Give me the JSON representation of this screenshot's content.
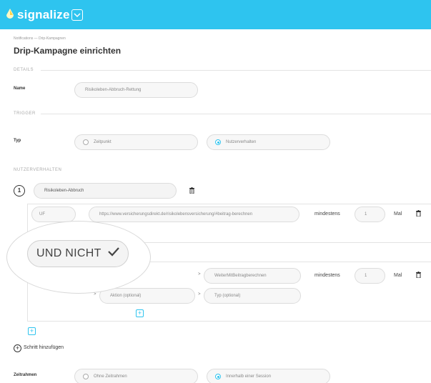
{
  "app": {
    "name": "signalize"
  },
  "breadcrumb": "Notifications — Drip-Kampagnen",
  "page_title": "Drip-Kampagne einrichten",
  "sections": {
    "details": "DETAILS",
    "trigger": "TRIGGER",
    "nutzerverhalten": "NUTZERVERHALTEN"
  },
  "details": {
    "name_label": "Name",
    "name_value": "Risikoleben-Abbruch-Rettung"
  },
  "trigger": {
    "typ_label": "Typ",
    "options": [
      {
        "label": "Zeitpunkt",
        "selected": false
      },
      {
        "label": "Nutzerverhalten",
        "selected": true
      }
    ]
  },
  "step1": {
    "number": "1",
    "name": "Risikoleben-Abbruch",
    "row1": {
      "prefix": "UF",
      "url": "https://www.versicherungsdirekt.de/risikolebensversicherung/#beitrag-berechnen",
      "mindestens_label": "mindestens",
      "count": "1",
      "unit": "Mal"
    },
    "row2": {
      "event": "WeiterMitBeitragberechnen",
      "mindestens_label": "mindestens",
      "count": "1",
      "unit": "Mal"
    },
    "action_placeholder": "Aktion (optional)",
    "type_placeholder": "Typ (optional)",
    "und_nicht_label": "UND NICHT"
  },
  "add_step_label": "Schritt hinzufügen",
  "zeitrahmen": {
    "label": "Zeitrahmen",
    "options": [
      {
        "label": "Ohne Zeitrahmen",
        "selected": false
      },
      {
        "label": "Innerhalb einer Session",
        "selected": true
      }
    ]
  },
  "colors": {
    "accent": "#2ec4ef",
    "text": "#333333"
  },
  "icons": [
    "signalize-logo-icon",
    "chevron-down-icon",
    "trash-icon",
    "plus-icon",
    "check-icon"
  ]
}
